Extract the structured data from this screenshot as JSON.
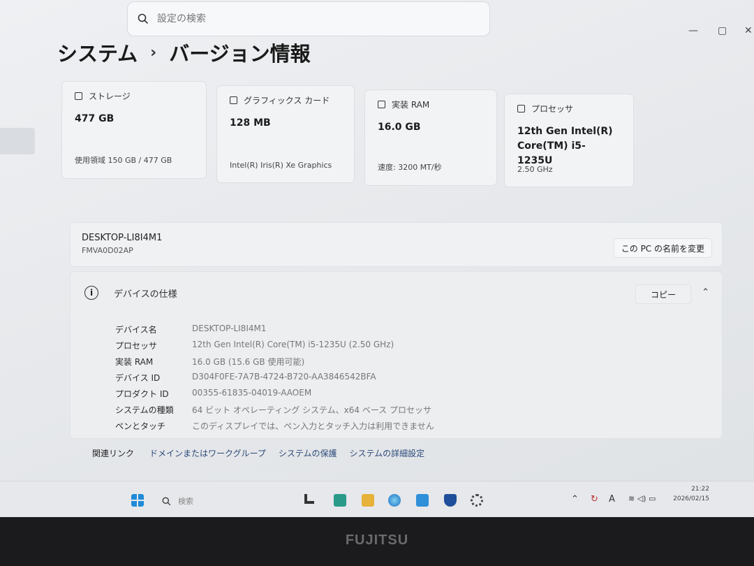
{
  "search": {
    "placeholder": "設定の検索"
  },
  "breadcrumb": {
    "parent": "システム",
    "separator": "›",
    "current": "バージョン情報"
  },
  "cards": [
    {
      "icon": "storage-icon",
      "label": "ストレージ",
      "value": "477 GB",
      "sub": "使用領域 150 GB / 477 GB"
    },
    {
      "icon": "graphics-card-icon",
      "label": "グラフィックス カード",
      "value": "128 MB",
      "sub": "Intel(R) Iris(R) Xe Graphics"
    },
    {
      "icon": "ram-icon",
      "label": "実装 RAM",
      "value": "16.0 GB",
      "sub": "速度: 3200 MT/秒"
    },
    {
      "icon": "processor-icon",
      "label": "プロセッサ",
      "value": "12th Gen Intel(R) Core(TM) i5-1235U",
      "sub": "2.50 GHz"
    }
  ],
  "device": {
    "name": "DESKTOP-LI8I4M1",
    "model": "FMVA0D02AP",
    "rename_label": "この PC の名前を変更"
  },
  "specs": {
    "title": "デバイスの仕様",
    "copy_label": "コピー",
    "rows": [
      {
        "key": "デバイス名",
        "value": "DESKTOP-LI8I4M1"
      },
      {
        "key": "プロセッサ",
        "value": "12th Gen Intel(R) Core(TM) i5-1235U (2.50 GHz)"
      },
      {
        "key": "実装 RAM",
        "value": "16.0 GB (15.6 GB 使用可能)"
      },
      {
        "key": "デバイス ID",
        "value": "D304F0FE-7A7B-4724-B720-AA3846542BFA"
      },
      {
        "key": "プロダクト ID",
        "value": "00355-61835-04019-AAOEM"
      },
      {
        "key": "システムの種類",
        "value": "64 ビット オペレーティング システム、x64 ベース プロセッサ"
      },
      {
        "key": "ペンとタッチ",
        "value": "このディスプレイでは、ペン入力とタッチ入力は利用できません"
      }
    ]
  },
  "related": {
    "label": "関連リンク",
    "links": [
      "ドメインまたはワークグループ",
      "システムの保護",
      "システムの詳細設定"
    ]
  },
  "taskbar": {
    "search_label": "検索",
    "time": "21:22",
    "date": "2026/02/15"
  },
  "bezel": {
    "brand": "FUJITSU"
  }
}
